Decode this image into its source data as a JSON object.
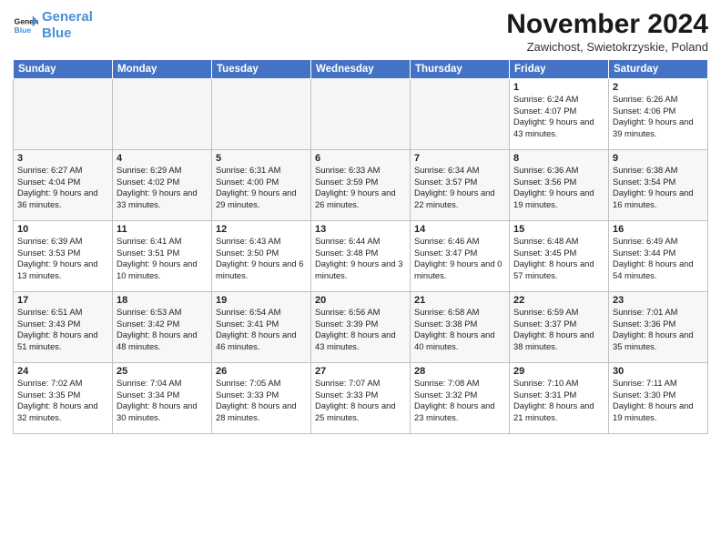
{
  "header": {
    "logo_line1": "General",
    "logo_line2": "Blue",
    "month_title": "November 2024",
    "location": "Zawichost, Swietokrzyskie, Poland"
  },
  "weekdays": [
    "Sunday",
    "Monday",
    "Tuesday",
    "Wednesday",
    "Thursday",
    "Friday",
    "Saturday"
  ],
  "weeks": [
    [
      {
        "day": "",
        "info": "",
        "empty": true
      },
      {
        "day": "",
        "info": "",
        "empty": true
      },
      {
        "day": "",
        "info": "",
        "empty": true
      },
      {
        "day": "",
        "info": "",
        "empty": true
      },
      {
        "day": "",
        "info": "",
        "empty": true
      },
      {
        "day": "1",
        "info": "Sunrise: 6:24 AM\nSunset: 4:07 PM\nDaylight: 9 hours and 43 minutes."
      },
      {
        "day": "2",
        "info": "Sunrise: 6:26 AM\nSunset: 4:06 PM\nDaylight: 9 hours and 39 minutes."
      }
    ],
    [
      {
        "day": "3",
        "info": "Sunrise: 6:27 AM\nSunset: 4:04 PM\nDaylight: 9 hours and 36 minutes."
      },
      {
        "day": "4",
        "info": "Sunrise: 6:29 AM\nSunset: 4:02 PM\nDaylight: 9 hours and 33 minutes."
      },
      {
        "day": "5",
        "info": "Sunrise: 6:31 AM\nSunset: 4:00 PM\nDaylight: 9 hours and 29 minutes."
      },
      {
        "day": "6",
        "info": "Sunrise: 6:33 AM\nSunset: 3:59 PM\nDaylight: 9 hours and 26 minutes."
      },
      {
        "day": "7",
        "info": "Sunrise: 6:34 AM\nSunset: 3:57 PM\nDaylight: 9 hours and 22 minutes."
      },
      {
        "day": "8",
        "info": "Sunrise: 6:36 AM\nSunset: 3:56 PM\nDaylight: 9 hours and 19 minutes."
      },
      {
        "day": "9",
        "info": "Sunrise: 6:38 AM\nSunset: 3:54 PM\nDaylight: 9 hours and 16 minutes."
      }
    ],
    [
      {
        "day": "10",
        "info": "Sunrise: 6:39 AM\nSunset: 3:53 PM\nDaylight: 9 hours and 13 minutes."
      },
      {
        "day": "11",
        "info": "Sunrise: 6:41 AM\nSunset: 3:51 PM\nDaylight: 9 hours and 10 minutes."
      },
      {
        "day": "12",
        "info": "Sunrise: 6:43 AM\nSunset: 3:50 PM\nDaylight: 9 hours and 6 minutes."
      },
      {
        "day": "13",
        "info": "Sunrise: 6:44 AM\nSunset: 3:48 PM\nDaylight: 9 hours and 3 minutes."
      },
      {
        "day": "14",
        "info": "Sunrise: 6:46 AM\nSunset: 3:47 PM\nDaylight: 9 hours and 0 minutes."
      },
      {
        "day": "15",
        "info": "Sunrise: 6:48 AM\nSunset: 3:45 PM\nDaylight: 8 hours and 57 minutes."
      },
      {
        "day": "16",
        "info": "Sunrise: 6:49 AM\nSunset: 3:44 PM\nDaylight: 8 hours and 54 minutes."
      }
    ],
    [
      {
        "day": "17",
        "info": "Sunrise: 6:51 AM\nSunset: 3:43 PM\nDaylight: 8 hours and 51 minutes."
      },
      {
        "day": "18",
        "info": "Sunrise: 6:53 AM\nSunset: 3:42 PM\nDaylight: 8 hours and 48 minutes."
      },
      {
        "day": "19",
        "info": "Sunrise: 6:54 AM\nSunset: 3:41 PM\nDaylight: 8 hours and 46 minutes."
      },
      {
        "day": "20",
        "info": "Sunrise: 6:56 AM\nSunset: 3:39 PM\nDaylight: 8 hours and 43 minutes."
      },
      {
        "day": "21",
        "info": "Sunrise: 6:58 AM\nSunset: 3:38 PM\nDaylight: 8 hours and 40 minutes."
      },
      {
        "day": "22",
        "info": "Sunrise: 6:59 AM\nSunset: 3:37 PM\nDaylight: 8 hours and 38 minutes."
      },
      {
        "day": "23",
        "info": "Sunrise: 7:01 AM\nSunset: 3:36 PM\nDaylight: 8 hours and 35 minutes."
      }
    ],
    [
      {
        "day": "24",
        "info": "Sunrise: 7:02 AM\nSunset: 3:35 PM\nDaylight: 8 hours and 32 minutes."
      },
      {
        "day": "25",
        "info": "Sunrise: 7:04 AM\nSunset: 3:34 PM\nDaylight: 8 hours and 30 minutes."
      },
      {
        "day": "26",
        "info": "Sunrise: 7:05 AM\nSunset: 3:33 PM\nDaylight: 8 hours and 28 minutes."
      },
      {
        "day": "27",
        "info": "Sunrise: 7:07 AM\nSunset: 3:33 PM\nDaylight: 8 hours and 25 minutes."
      },
      {
        "day": "28",
        "info": "Sunrise: 7:08 AM\nSunset: 3:32 PM\nDaylight: 8 hours and 23 minutes."
      },
      {
        "day": "29",
        "info": "Sunrise: 7:10 AM\nSunset: 3:31 PM\nDaylight: 8 hours and 21 minutes."
      },
      {
        "day": "30",
        "info": "Sunrise: 7:11 AM\nSunset: 3:30 PM\nDaylight: 8 hours and 19 minutes."
      }
    ]
  ]
}
